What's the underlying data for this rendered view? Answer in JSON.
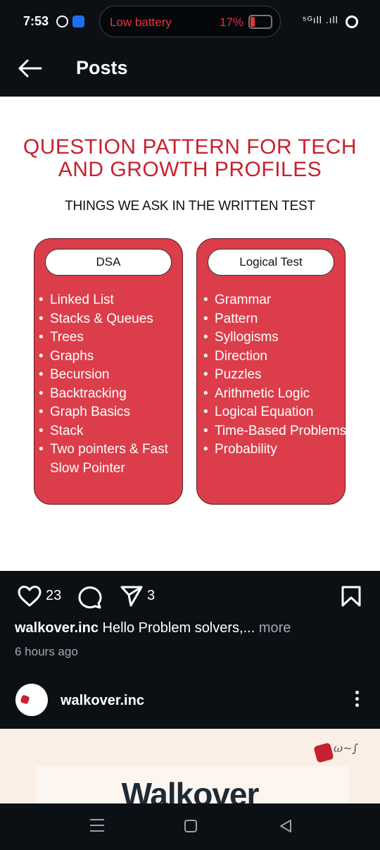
{
  "status_bar": {
    "time": "7:53",
    "battery_label": "Low battery",
    "battery_percent": "17%",
    "signal": "⁵ᴳıll .ıll",
    "icons": [
      "whatsapp-icon",
      "app-notification-icon",
      "battery-icon",
      "signal-icon",
      "ring-icon"
    ]
  },
  "header": {
    "title": "Posts"
  },
  "post_image": {
    "title": "QUESTION PATTERN FOR TECH AND GROWTH PROFILES",
    "subtitle": "THINGS WE ASK IN THE WRITTEN TEST",
    "dsa_card": {
      "heading": "DSA",
      "items": [
        "Linked List",
        "Stacks & Queues",
        "Trees",
        "Graphs",
        "Becursion",
        "Backtracking",
        "Graph Basics",
        "Stack",
        "Two pointers & Fast Slow Pointer"
      ]
    },
    "logical_card": {
      "heading": "Logical Test",
      "items": [
        "Grammar",
        "Pattern",
        "Syllogisms",
        "Direction",
        "Puzzles",
        "Arithmetic Logic",
        "Logical Equation",
        "Time-Based Problems",
        "Probability"
      ]
    }
  },
  "actions": {
    "like_count": "23",
    "share_count": "3"
  },
  "caption": {
    "username": "walkover.inc",
    "text": " Hello Problem solvers,...",
    "more": " more",
    "time_ago": "6 hours ago"
  },
  "next_post": {
    "username": "walkover.inc",
    "image_title": "Walkover"
  },
  "colors": {
    "background": "#0b1015",
    "accent_red": "#c8202e",
    "card_red": "#dc3d4a",
    "muted_text": "#a3a8ae"
  }
}
